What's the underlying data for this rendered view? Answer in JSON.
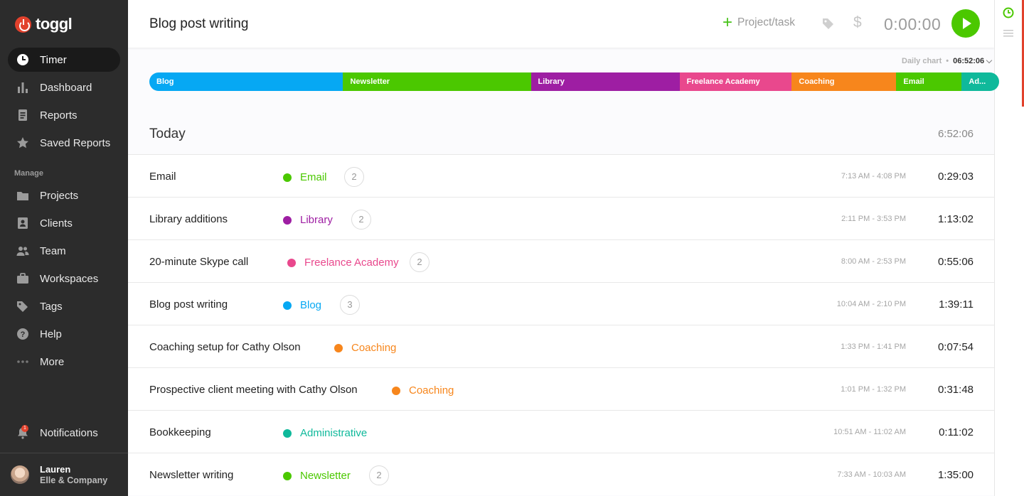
{
  "app": {
    "logo_text": "toggl",
    "brand_color": "#e2412c"
  },
  "sidebar": {
    "items": [
      {
        "label": "Timer",
        "icon": "clock-icon"
      },
      {
        "label": "Dashboard",
        "icon": "bar-chart-icon"
      },
      {
        "label": "Reports",
        "icon": "document-icon"
      },
      {
        "label": "Saved Reports",
        "icon": "star-icon"
      }
    ],
    "manage_label": "Manage",
    "manage_items": [
      {
        "label": "Projects",
        "icon": "folder-icon"
      },
      {
        "label": "Clients",
        "icon": "contact-card-icon"
      },
      {
        "label": "Team",
        "icon": "people-icon"
      },
      {
        "label": "Workspaces",
        "icon": "briefcase-icon"
      },
      {
        "label": "Tags",
        "icon": "tag-icon"
      },
      {
        "label": "Help",
        "icon": "question-icon"
      },
      {
        "label": "More",
        "icon": "more-dots-icon"
      }
    ],
    "notifications": {
      "label": "Notifications",
      "badge": "1"
    },
    "user": {
      "name": "Lauren",
      "org": "Elle & Company"
    }
  },
  "topbar": {
    "description": "Blog post writing",
    "project_task_label": "Project/task",
    "timer": "0:00:00"
  },
  "daily_chart": {
    "label": "Daily chart",
    "separator": "•",
    "value": "06:52:06",
    "segments": [
      {
        "label": "Blog",
        "color": "#06a8f3",
        "share": 0.228
      },
      {
        "label": "Newsletter",
        "color": "#4bc800",
        "share": 0.221
      },
      {
        "label": "Library",
        "color": "#9e1ea3",
        "share": 0.175
      },
      {
        "label": "Freelance Academy",
        "color": "#e9488d",
        "share": 0.132
      },
      {
        "label": "Coaching",
        "color": "#f7861c",
        "share": 0.123
      },
      {
        "label": "Email",
        "color": "#4bc800",
        "share": 0.077
      },
      {
        "label": "Ad...",
        "color": "#0fb99b",
        "share": 0.044
      }
    ]
  },
  "today": {
    "label": "Today",
    "total": "6:52:06",
    "entries": [
      {
        "title": "Email",
        "project": "Email",
        "color": "#4bc800",
        "count": "2",
        "range": "7:13 AM - 4:08 PM",
        "duration": "0:29:03"
      },
      {
        "title": "Library additions",
        "project": "Library",
        "color": "#9e1ea3",
        "count": "2",
        "range": "2:11 PM - 3:53 PM",
        "duration": "1:13:02"
      },
      {
        "title": "20-minute Skype call",
        "project": "Freelance Academy",
        "color": "#e9488d",
        "count": "2",
        "range": "8:00 AM - 2:53 PM",
        "duration": "0:55:06"
      },
      {
        "title": "Blog post writing",
        "project": "Blog",
        "color": "#06a8f3",
        "count": "3",
        "range": "10:04 AM - 2:10 PM",
        "duration": "1:39:11"
      },
      {
        "title": "Coaching setup for Cathy Olson",
        "project": "Coaching",
        "color": "#f7861c",
        "count": "",
        "range": "1:33 PM - 1:41 PM",
        "duration": "0:07:54"
      },
      {
        "title": "Prospective client meeting with Cathy Olson",
        "project": "Coaching",
        "color": "#f7861c",
        "count": "",
        "range": "1:01 PM - 1:32 PM",
        "duration": "0:31:48"
      },
      {
        "title": "Bookkeeping",
        "project": "Administrative",
        "color": "#0fb99b",
        "count": "",
        "range": "10:51 AM - 11:02 AM",
        "duration": "0:11:02"
      },
      {
        "title": "Newsletter writing",
        "project": "Newsletter",
        "color": "#4bc800",
        "count": "2",
        "range": "7:33 AM - 10:03 AM",
        "duration": "1:35:00"
      }
    ]
  }
}
